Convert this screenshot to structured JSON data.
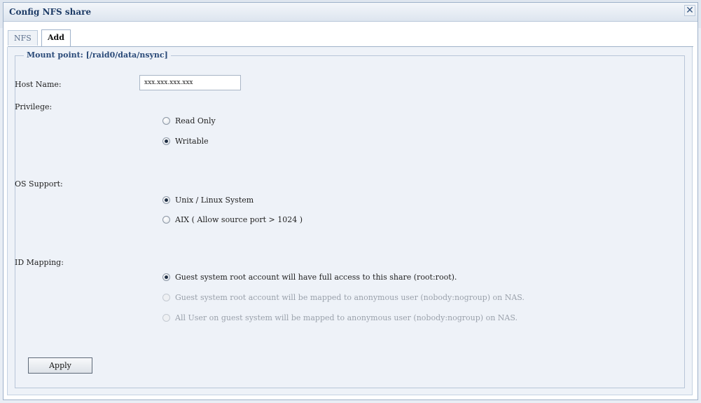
{
  "window": {
    "title": "Config NFS share"
  },
  "tabs": [
    {
      "label": "NFS"
    },
    {
      "label": "Add"
    }
  ],
  "mount_point_legend": "Mount point: [/raid0/data/nsync]",
  "host_name": {
    "label": "Host Name:",
    "value": "xxx.xxx.xxx.xxx"
  },
  "privilege": {
    "label": "Privilege:",
    "options": [
      {
        "label": "Read Only",
        "checked": false
      },
      {
        "label": "Writable",
        "checked": true
      }
    ]
  },
  "os_support": {
    "label": "OS Support:",
    "options": [
      {
        "label": "Unix / Linux System",
        "checked": true
      },
      {
        "label": "AIX ( Allow source port > 1024 )",
        "checked": false
      }
    ]
  },
  "id_mapping": {
    "label": "ID Mapping:",
    "options": [
      {
        "label": "Guest system root account will have full access to this share (root:root).",
        "checked": true,
        "disabled": false
      },
      {
        "label": "Guest system root account will be mapped to anonymous user (nobody:nogroup) on NAS.",
        "checked": false,
        "disabled": true
      },
      {
        "label": "All User on guest system will be mapped to anonymous user (nobody:nogroup) on NAS.",
        "checked": false,
        "disabled": true
      }
    ]
  },
  "apply_label": "Apply"
}
